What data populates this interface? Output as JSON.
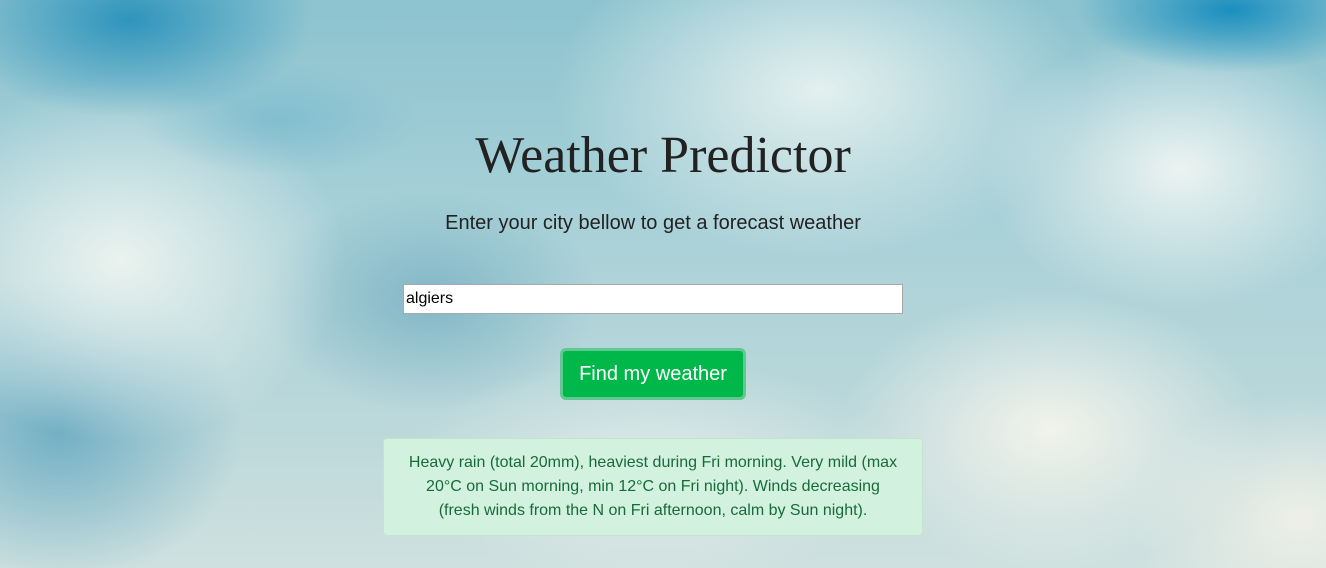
{
  "header": {
    "title": "Weather Predictor",
    "subtitle": "Enter your city bellow to get a forecast weather"
  },
  "search": {
    "value": "algiers",
    "button_label": "Find my weather"
  },
  "result": {
    "text": "Heavy rain (total 20mm), heaviest during Fri morning. Very mild (max 20°C on Sun morning, min 12°C on Fri night). Winds decreasing (fresh winds from the N on Fri afternoon, calm by Sun night)."
  },
  "colors": {
    "button_bg": "#00b84a",
    "alert_bg": "#d2f1df",
    "alert_text": "#176b3a"
  }
}
